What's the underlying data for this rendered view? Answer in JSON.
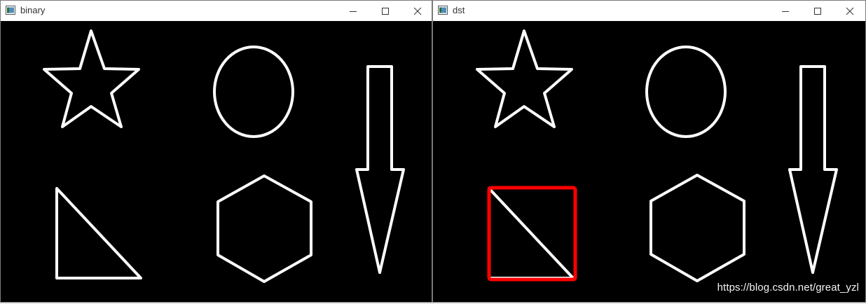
{
  "windows": {
    "left": {
      "title": "binary",
      "buttons": {
        "minimize": "minimize-icon",
        "maximize": "maximize-icon",
        "close": "close-icon"
      }
    },
    "right": {
      "title": "dst",
      "buttons": {
        "minimize": "minimize-icon",
        "maximize": "maximize-icon",
        "close": "close-icon"
      }
    }
  },
  "colors": {
    "shape_stroke": "#ffffff",
    "highlight_box": "#ff0000",
    "canvas_background": "#000000",
    "titlebar": "#ffffff"
  },
  "shapes": [
    "star",
    "ellipse",
    "down-arrow",
    "right-triangle",
    "hexagon"
  ],
  "highlighted_shape": "right-triangle",
  "watermark": "https://blog.csdn.net/great_yzl"
}
